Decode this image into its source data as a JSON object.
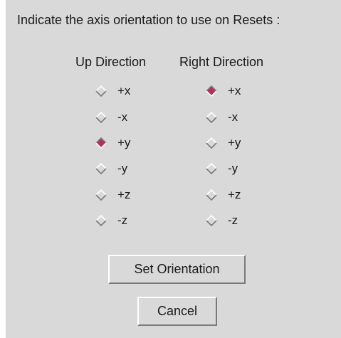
{
  "prompt": "Indicate the axis orientation to use on Resets :",
  "up_direction": {
    "header": "Up Direction",
    "options": [
      {
        "label": "+x",
        "selected": false
      },
      {
        "label": "-x",
        "selected": false
      },
      {
        "label": "+y",
        "selected": true
      },
      {
        "label": "-y",
        "selected": false
      },
      {
        "label": "+z",
        "selected": false
      },
      {
        "label": "-z",
        "selected": false
      }
    ]
  },
  "right_direction": {
    "header": "Right Direction",
    "options": [
      {
        "label": "+x",
        "selected": true
      },
      {
        "label": "-x",
        "selected": false
      },
      {
        "label": "+y",
        "selected": false
      },
      {
        "label": "-y",
        "selected": false
      },
      {
        "label": "+z",
        "selected": false
      },
      {
        "label": "-z",
        "selected": false
      }
    ]
  },
  "buttons": {
    "set_orientation": "Set Orientation",
    "cancel": "Cancel"
  },
  "colors": {
    "background": "#d9d9d9",
    "selected_fill": "#b03060",
    "unselected_fill": "#d9d9d9",
    "highlight": "#ffffff",
    "shadow": "#7a7a7a"
  }
}
